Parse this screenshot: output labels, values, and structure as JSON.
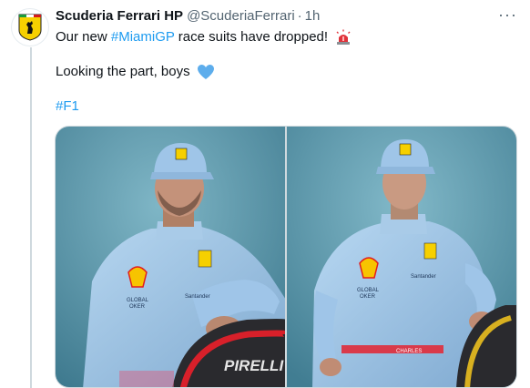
{
  "tweet": {
    "author_name": "Scuderia Ferrari HP",
    "handle": "@ScuderiaFerrari",
    "separator": "·",
    "time": "1h",
    "line1_prefix": "Our new ",
    "line1_hashtag": "#MiamiGP",
    "line1_suffix": " race suits have dropped!",
    "line2": "Looking the part, boys",
    "line3_hashtag": "#F1",
    "more_label": "···"
  },
  "media": {
    "left_photo": {
      "suit_text": [
        "Santander",
        "GLOBAL",
        "OKER"
      ],
      "tire_text": "PIRELLI"
    },
    "right_photo": {
      "suit_text": [
        "Santander",
        "GLOBAL",
        "OKER",
        "CHARLES"
      ]
    }
  },
  "colors": {
    "link": "#1d9bf0",
    "suit": "#9fc5e8",
    "backdrop": "#5f9fb4",
    "ferrari_yellow": "#f6d000"
  },
  "icons": {
    "avatar": "ferrari-shield-icon",
    "more": "more-horizontal-icon",
    "siren_emoji": "rotating-light-icon",
    "heart_emoji": "blue-heart-icon"
  }
}
